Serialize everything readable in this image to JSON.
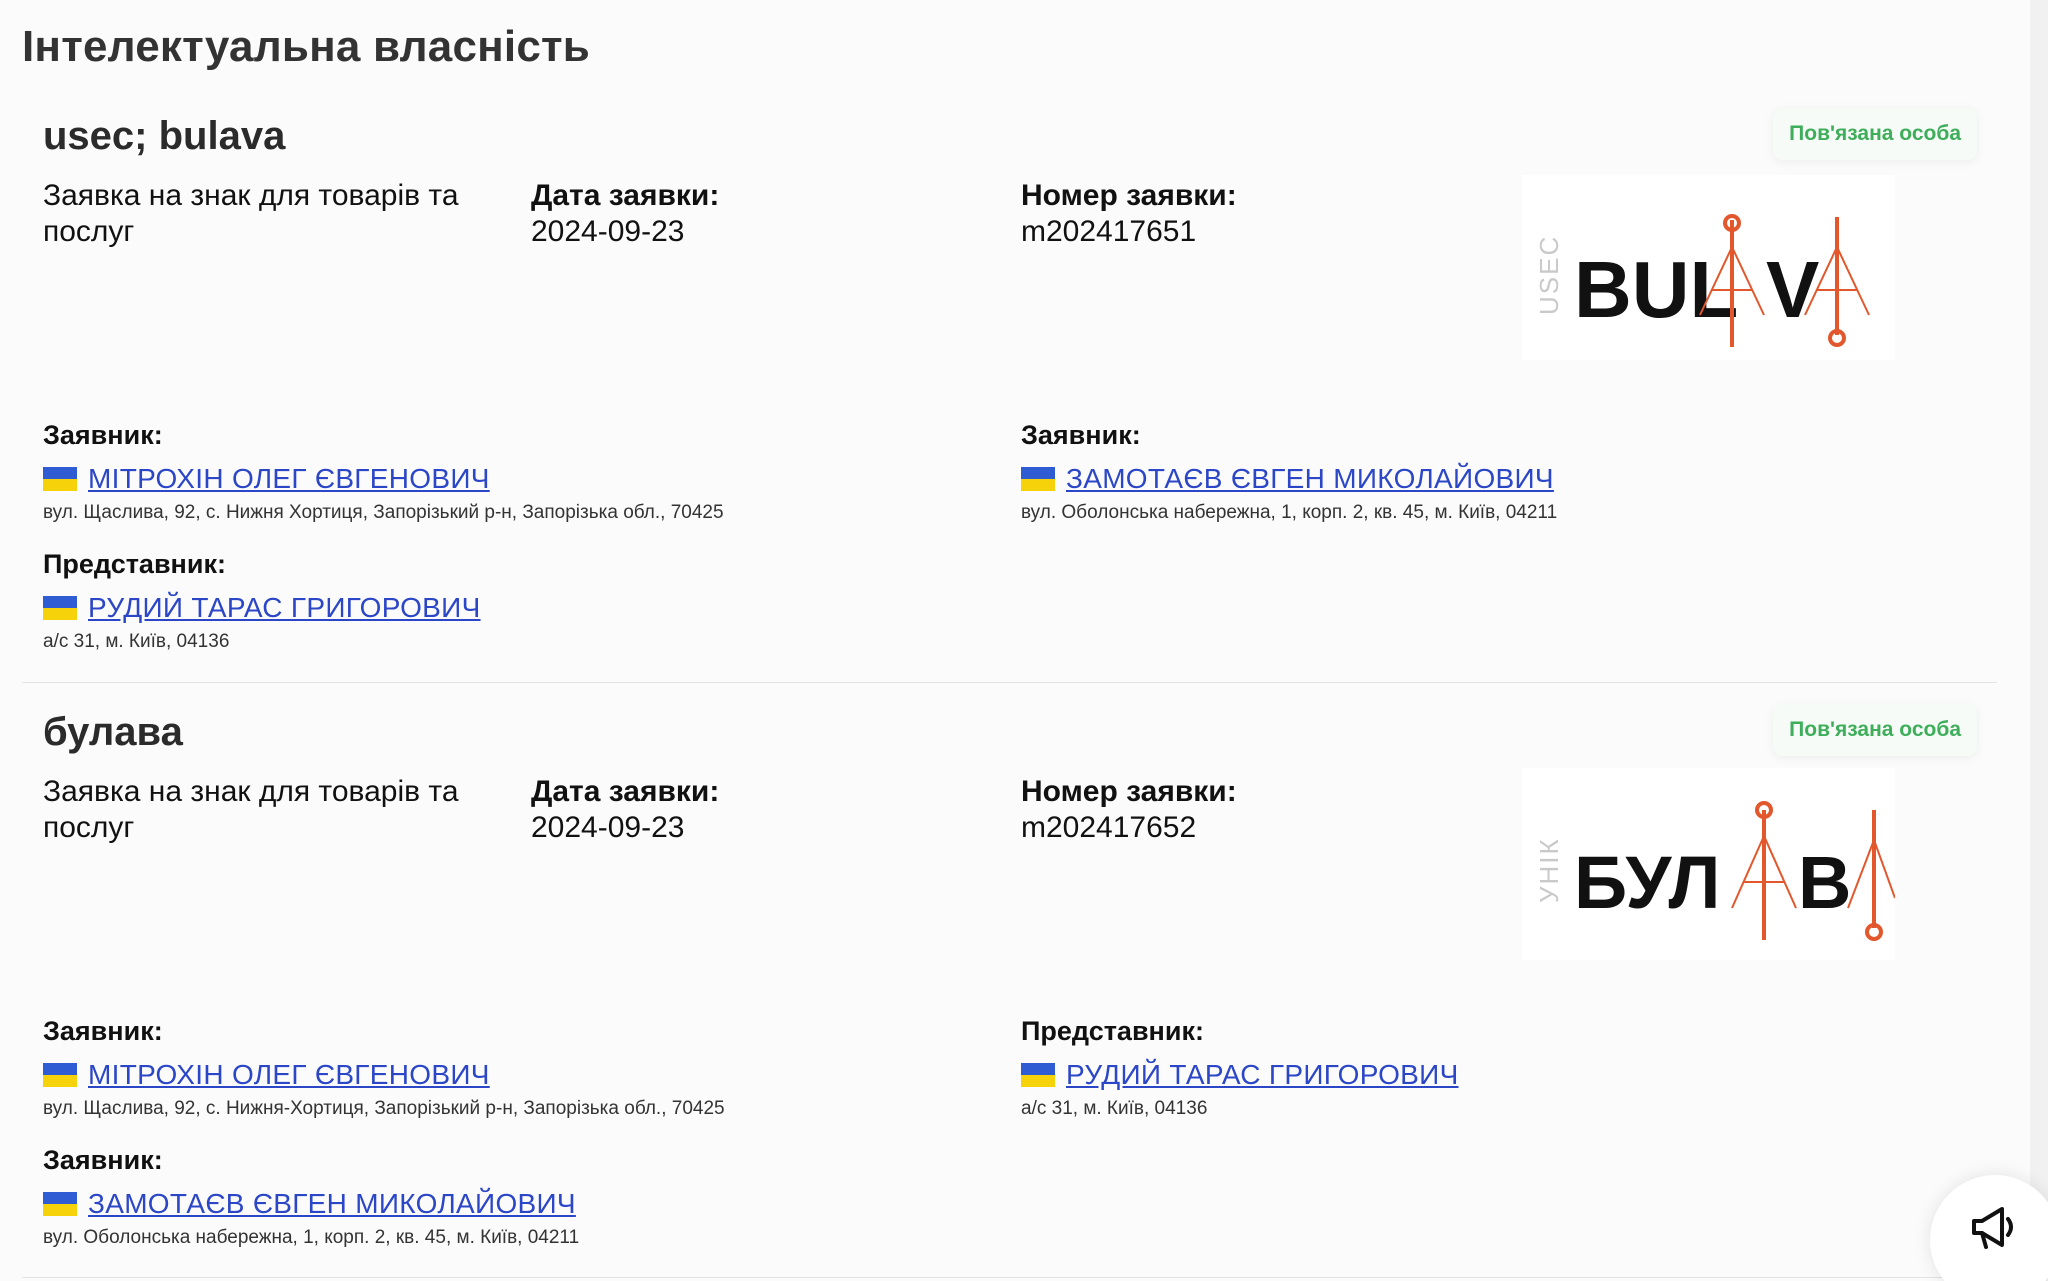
{
  "page": {
    "title": "Інтелектуальна власність"
  },
  "records": [
    {
      "name": "usec; bulava",
      "badge": "Пов'язана особа",
      "type": "Заявка на знак для товарів та послуг",
      "date_label": "Дата заявки:",
      "date": "2024-09-23",
      "number_label": "Номер заявки:",
      "number": "m202417651",
      "logo": {
        "side_text": "USEC",
        "word": "BULAVA",
        "accent": "#e2572c"
      },
      "parties": [
        {
          "role": "Заявник:",
          "name": "МІТРОХІН ОЛЕГ ЄВГЕНОВИЧ",
          "address": "вул. Щаслива, 92, с. Нижня Хортиця, Запорізький р-н, Запорізька обл., 70425"
        },
        {
          "role": "Заявник:",
          "name": "ЗАМОТАЄВ ЄВГЕН МИКОЛАЙОВИЧ",
          "address": "вул. Оболонська набережна, 1, корп. 2, кв. 45, м. Київ, 04211"
        },
        {
          "role": "Представник:",
          "name": "РУДИЙ ТАРАС ГРИГОРОВИЧ",
          "address": "а/с 31, м. Київ, 04136"
        }
      ]
    },
    {
      "name": "булава",
      "badge": "Пов'язана особа",
      "type": "Заявка на знак для товарів та послуг",
      "date_label": "Дата заявки:",
      "date": "2024-09-23",
      "number_label": "Номер заявки:",
      "number": "m202417652",
      "logo": {
        "side_text": "УНІК",
        "word": "БУЛАВА",
        "accent": "#e2572c"
      },
      "parties": [
        {
          "role": "Заявник:",
          "name": "МІТРОХІН ОЛЕГ ЄВГЕНОВИЧ",
          "address": "вул. Щаслива, 92, с. Нижня-Хортиця, Запорізький р-н, Запорізька обл., 70425"
        },
        {
          "role": "Представник:",
          "name": "РУДИЙ ТАРАС ГРИГОРОВИЧ",
          "address": "а/с 31, м. Київ, 04136"
        },
        {
          "role": "Заявник:",
          "name": "ЗАМОТАЄВ ЄВГЕН МИКОЛАЙОВИЧ",
          "address": "вул. Оболонська набережна, 1, корп. 2, кв. 45, м. Київ, 04211"
        }
      ]
    }
  ],
  "feedback_button": {
    "icon": "megaphone-icon"
  },
  "colors": {
    "link": "#2b46c7",
    "badge_text": "#3fae5b",
    "flag_blue": "#2f5bd3",
    "flag_yellow": "#f5d20a"
  }
}
